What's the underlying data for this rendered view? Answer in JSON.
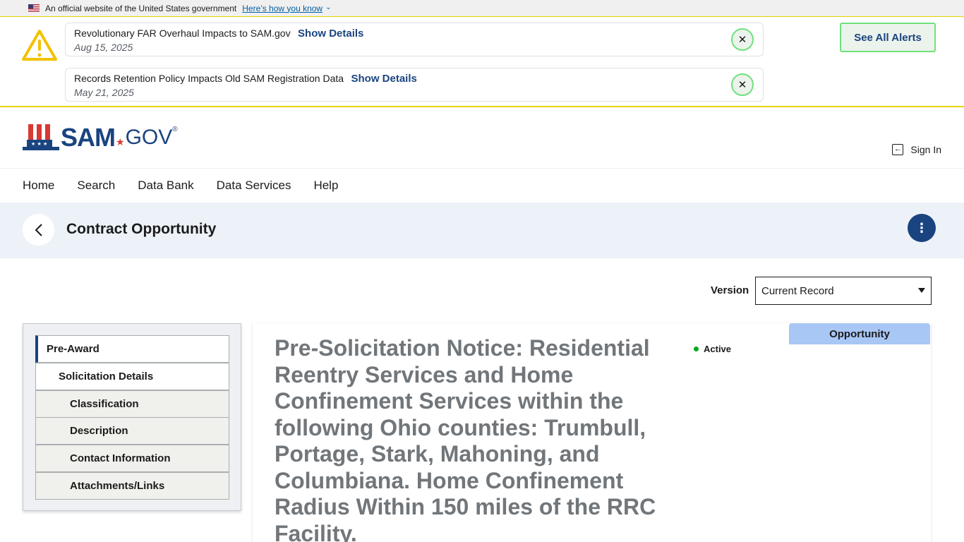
{
  "gov_banner": {
    "text": "An official website of the United States government",
    "link": "Here’s how you know"
  },
  "alerts": {
    "items": [
      {
        "title": "Revolutionary FAR Overhaul Impacts to SAM.gov",
        "action": "Show Details",
        "date": "Aug 15, 2025"
      },
      {
        "title": "Records Retention Policy Impacts Old SAM Registration Data",
        "action": "Show Details",
        "date": "May 21, 2025"
      }
    ],
    "see_all": "See All Alerts"
  },
  "header": {
    "logo_sam": "SAM",
    "logo_gov": "GOV",
    "logo_reg": "®",
    "sign_in": "Sign In"
  },
  "nav": {
    "items": [
      "Home",
      "Search",
      "Data Bank",
      "Data Services",
      "Help"
    ]
  },
  "page": {
    "title": "Contract Opportunity",
    "more_icon": "⋮"
  },
  "version": {
    "label": "Version",
    "selected": "Current Record"
  },
  "sidenav": {
    "items": [
      "Pre-Award",
      "Solicitation Details",
      "Classification",
      "Description",
      "Contact Information",
      "Attachments/Links"
    ]
  },
  "main": {
    "tag": "Opportunity",
    "status": "Active",
    "title": "Pre-Solicitation Notice: Residential Reentry Services and Home Confinement Services within the following Ohio counties: Trumbull, Portage, Stark, Mahoning, and Columbiana. Home Confinement Radius Within 150 miles of the RRC Facility."
  },
  "colors": {
    "primary": "#1a4480",
    "alert_border": "#e5d600",
    "close_green": "#70e17b",
    "status_active": "#00a91c",
    "opportunity_tag": "#a8c7f5",
    "page_band": "#edf2f8"
  }
}
